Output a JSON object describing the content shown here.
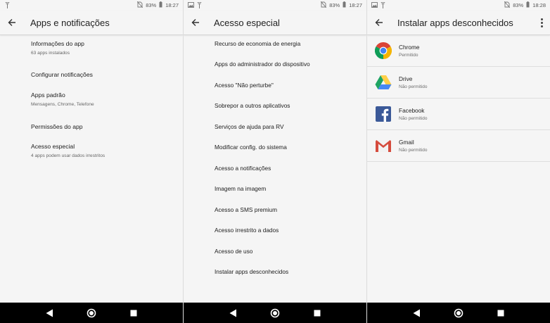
{
  "status_bars": [
    {
      "battery": "83%",
      "time": "18:27"
    },
    {
      "battery": "83%",
      "time": "18:27"
    },
    {
      "battery": "83%",
      "time": "18:28"
    }
  ],
  "screen1": {
    "title": "Apps e notificações",
    "items": [
      {
        "title": "Informações do app",
        "subtitle": "63 apps instalados"
      },
      {
        "title": "Configurar notificações",
        "subtitle": ""
      },
      {
        "title": "Apps padrão",
        "subtitle": "Mensagens, Chrome, Telefone"
      },
      {
        "title": "Permissões do app",
        "subtitle": ""
      },
      {
        "title": "Acesso especial",
        "subtitle": "4 apps podem usar dados irrestritos"
      }
    ]
  },
  "screen2": {
    "title": "Acesso especial",
    "items": [
      "Recurso de economia de energia",
      "Apps do administrador do dispositivo",
      "Acesso \"Não perturbe\"",
      "Sobrepor a outros aplicativos",
      "Serviços de ajuda para RV",
      "Modificar config. do sistema",
      "Acesso a notificações",
      "Imagem na imagem",
      "Acesso a SMS premium",
      "Acesso irrestrito a dados",
      "Acesso de uso",
      "Instalar apps desconhecidos"
    ]
  },
  "screen3": {
    "title": "Instalar apps desconhecidos",
    "apps": [
      {
        "name": "Chrome",
        "status": "Permitido",
        "icon": "chrome-icon"
      },
      {
        "name": "Drive",
        "status": "Não permitido",
        "icon": "drive-icon"
      },
      {
        "name": "Facebook",
        "status": "Não permitido",
        "icon": "facebook-icon"
      },
      {
        "name": "Gmail",
        "status": "Não permitido",
        "icon": "gmail-icon"
      }
    ]
  },
  "icons": {
    "back": "arrow-back-icon",
    "overflow": "more-vert-icon",
    "nav": [
      "back-triangle-icon",
      "home-circle-icon",
      "recents-square-icon"
    ]
  }
}
